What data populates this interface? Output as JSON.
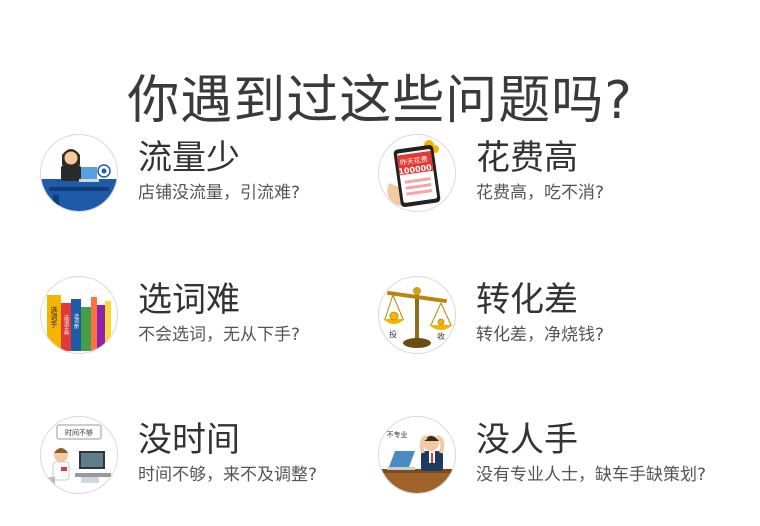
{
  "title": "你遇到过这些问题吗?",
  "problems": [
    {
      "title": "流量少",
      "desc": "店铺没流量，引流难?",
      "icon": "customer-service-icon"
    },
    {
      "title": "花费高",
      "desc": "花费高，吃不消?",
      "icon": "phone-bill-icon",
      "icon_text": {
        "line1": "昨天花费",
        "line2": "100000"
      }
    },
    {
      "title": "选词难",
      "desc": "不会选词，无从下手?",
      "icon": "books-icon",
      "icon_text": {
        "book1": "选词手",
        "book2": "选词字典",
        "book3": "选词册"
      }
    },
    {
      "title": "转化差",
      "desc": "转化差，净烧钱?",
      "icon": "balance-scale-icon",
      "icon_text": {
        "left": "投",
        "right": "收"
      }
    },
    {
      "title": "没时间",
      "desc": "时间不够，来不及调整?",
      "icon": "busy-worker-icon",
      "icon_text": {
        "bubble": "时间不够"
      }
    },
    {
      "title": "没人手",
      "desc": "没有专业人士，缺车手缺策划?",
      "icon": "frustrated-worker-icon",
      "icon_text": {
        "sign": "不专业"
      }
    }
  ],
  "colors": {
    "title": "#3a3a3a",
    "text": "#333333",
    "desc": "#555555",
    "circle_border": "#d9d9d9",
    "accent_red": "#e53935",
    "accent_gold": "#f5b400",
    "accent_blue": "#1e5aa8"
  }
}
